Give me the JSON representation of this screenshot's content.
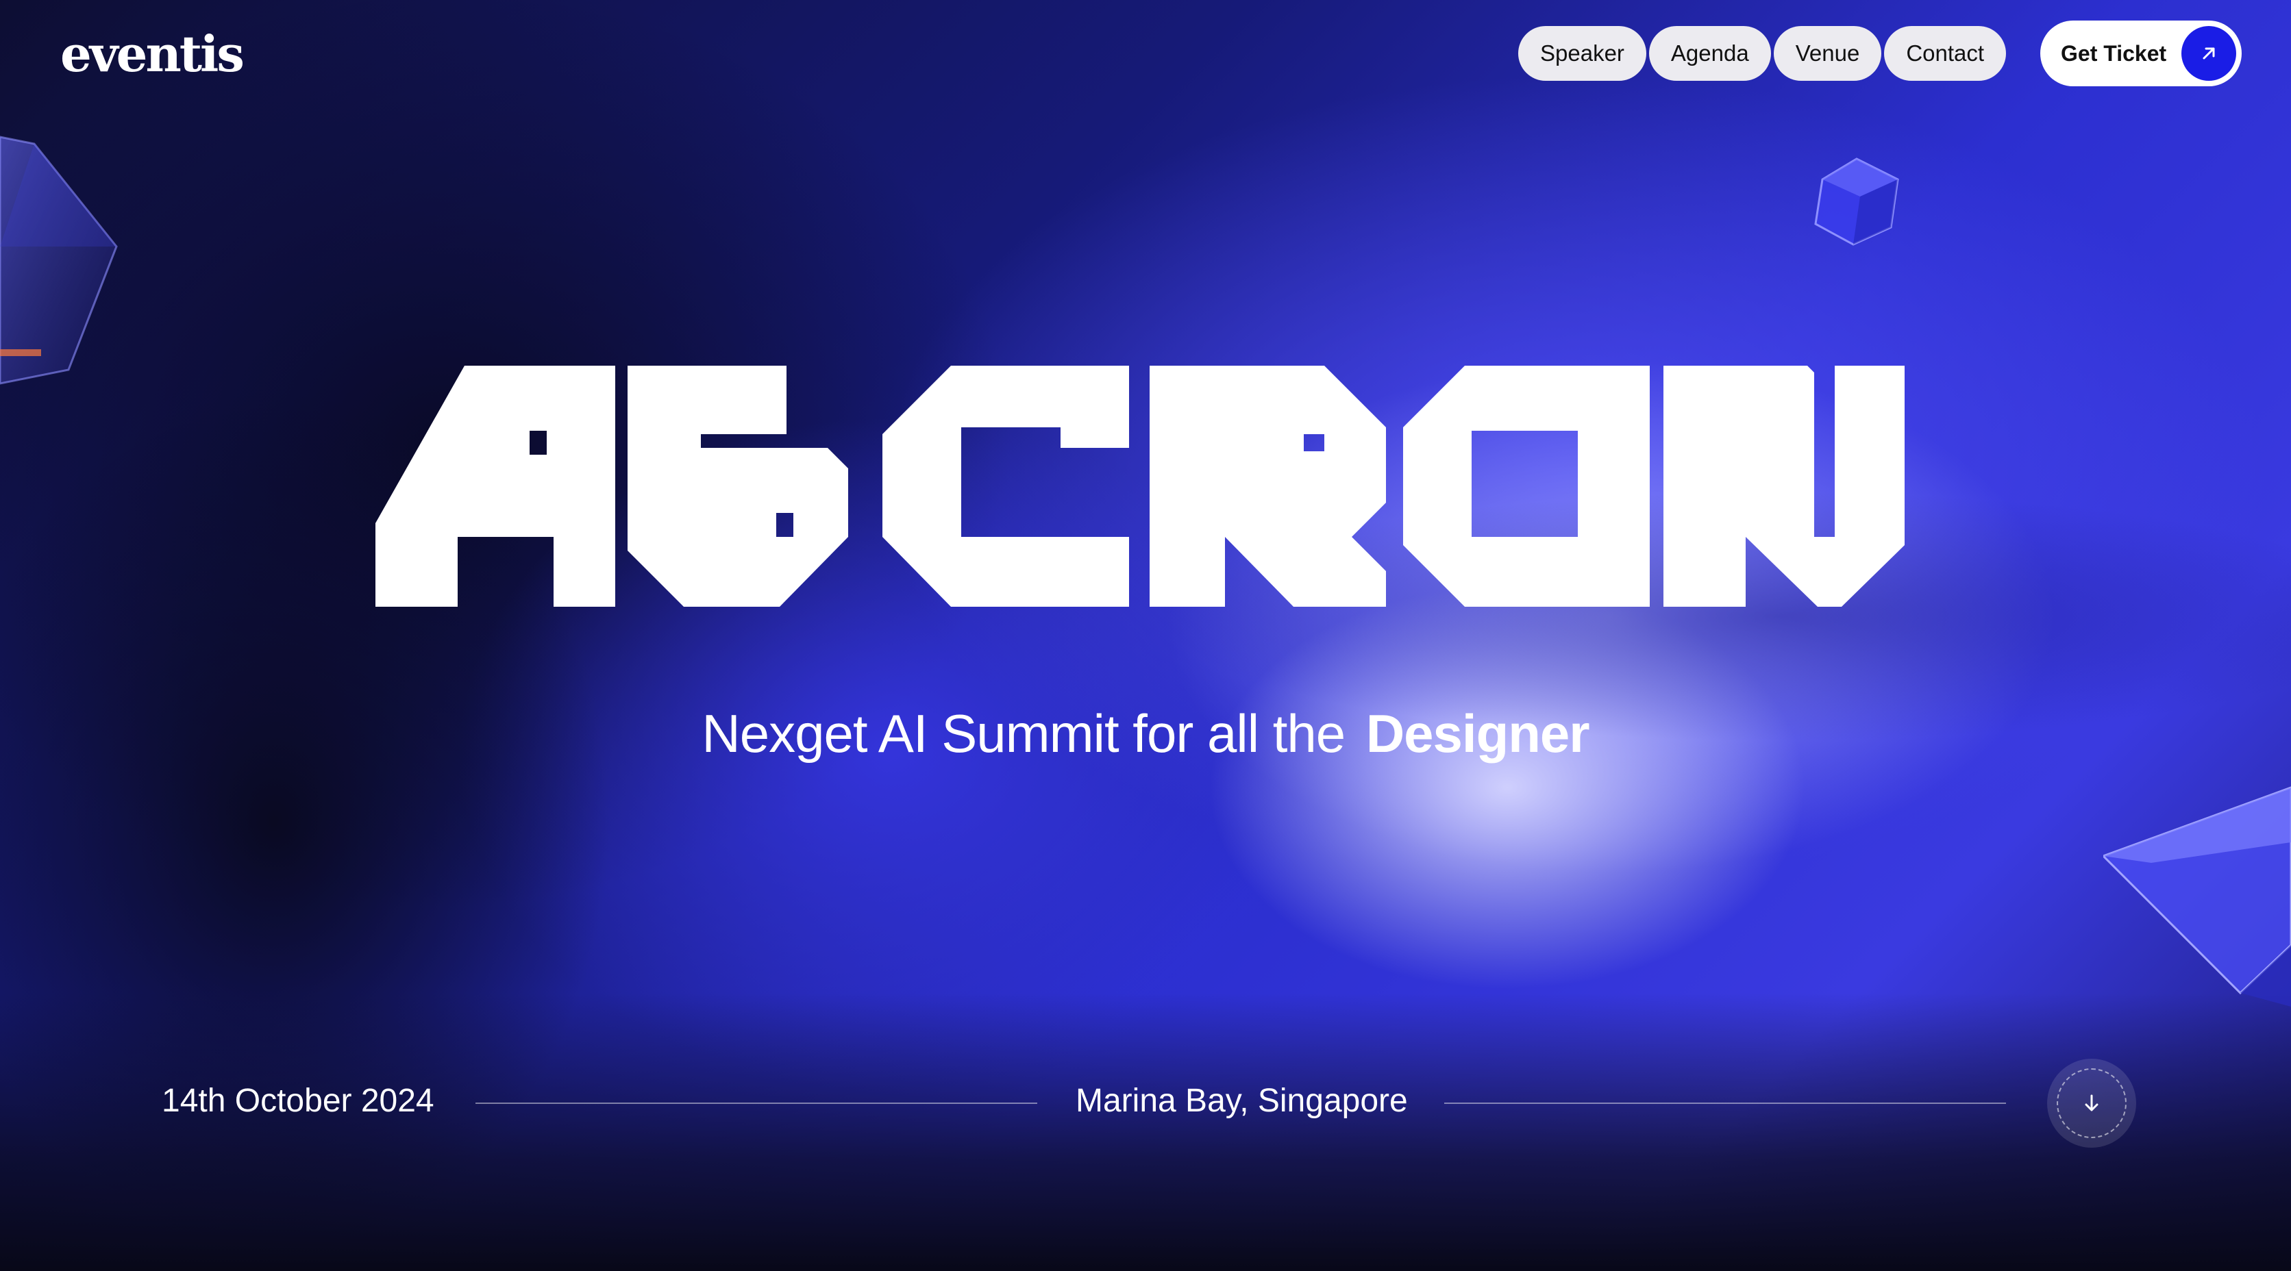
{
  "brand": {
    "logo_text": "eventis"
  },
  "nav": {
    "items": [
      {
        "label": "Speaker"
      },
      {
        "label": "Agenda"
      },
      {
        "label": "Venue"
      },
      {
        "label": "Contact"
      }
    ],
    "cta_label": "Get Ticket",
    "cta_icon": "arrow-up-right-icon"
  },
  "hero": {
    "title": "AICRON",
    "subtitle_regular": "Nexget AI Summit for all the",
    "subtitle_emphasis": "Designer"
  },
  "event": {
    "date": "14th October 2024",
    "location": "Marina Bay, Singapore",
    "scroll_icon": "arrow-down-icon"
  },
  "colors": {
    "accent": "#1a1de6",
    "background_dark": "#0b0c24",
    "background_blue": "#3a3ae0",
    "pill_bg": "#ecebf0"
  }
}
